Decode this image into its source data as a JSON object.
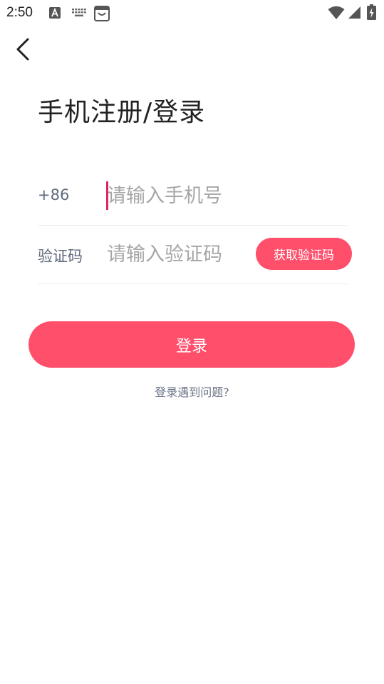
{
  "status_bar": {
    "time": "2:50",
    "icons": [
      "app-a-icon",
      "keyboard-icon",
      "shopping-bag-icon",
      "wifi-icon",
      "signal-icon",
      "battery-charging-icon"
    ]
  },
  "nav": {
    "back_icon": "chevron-left-icon"
  },
  "page": {
    "title": "手机注册/登录"
  },
  "form": {
    "country_code": "+86",
    "phone_placeholder": "请输入手机号",
    "phone_value": "",
    "code_label": "验证码",
    "code_placeholder": "请输入验证码",
    "code_value": "",
    "get_code_label": "获取验证码"
  },
  "actions": {
    "login_label": "登录",
    "help_label": "登录遇到问题?"
  },
  "colors": {
    "accent": "#ff4f6b",
    "cursor": "#e0245e",
    "label": "#5f6a7d",
    "placeholder": "#a6a6a6",
    "title": "#222222"
  }
}
